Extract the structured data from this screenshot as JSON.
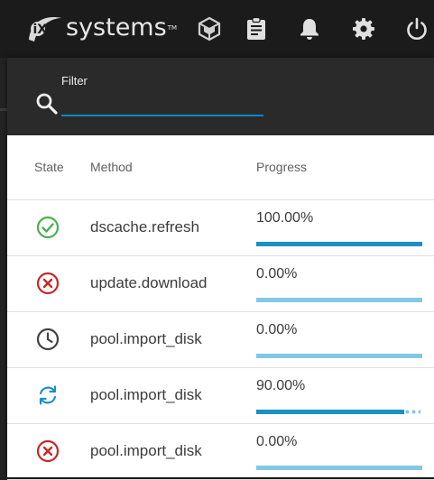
{
  "app": {
    "logo_mark": "iX",
    "logo_text": "systems",
    "logo_tm": "TM"
  },
  "toolbar": {
    "icons": [
      "truecommand-icon",
      "task-manager-icon",
      "bell-icon",
      "gear-icon",
      "power-icon"
    ]
  },
  "filter": {
    "label": "Filter",
    "value": ""
  },
  "table": {
    "headers": {
      "state": "State",
      "method": "Method",
      "progress": "Progress"
    },
    "rows": [
      {
        "state": "success",
        "method": "dscache.refresh",
        "progress_text": "100.00%",
        "progress": 100
      },
      {
        "state": "failed",
        "method": "update.download",
        "progress_text": "0.00%",
        "progress": 0
      },
      {
        "state": "waiting",
        "method": "pool.import_disk",
        "progress_text": "0.00%",
        "progress": 0
      },
      {
        "state": "running",
        "method": "pool.import_disk",
        "progress_text": "90.00%",
        "progress": 90
      },
      {
        "state": "failed",
        "method": "pool.import_disk",
        "progress_text": "0.00%",
        "progress": 0
      }
    ]
  },
  "colors": {
    "success": "#4caf50",
    "failed": "#c62828",
    "waiting": "#424242",
    "running": "#1a8fc9",
    "progress_fill": "#1a8fc9",
    "progress_track": "#82c8e6",
    "input_underline": "#0d88c4"
  }
}
